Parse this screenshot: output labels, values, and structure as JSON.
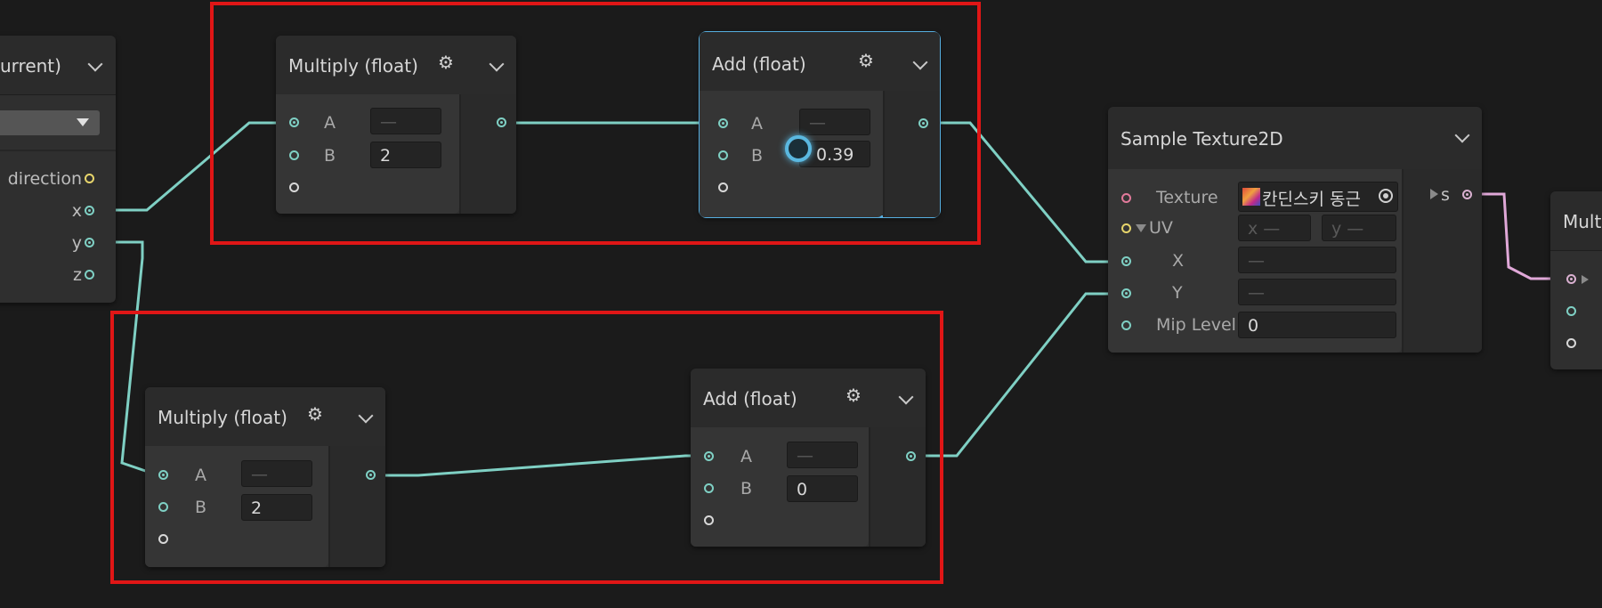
{
  "colors": {
    "background": "#1b1b1b",
    "wire": "#7fd0c4",
    "wire_pink": "#e0a8d8",
    "highlight_red": "#e01616",
    "selected_outline": "#56aee0"
  },
  "left_node": {
    "title_fragment": "urrent)",
    "ports": [
      {
        "label": "direction",
        "icon": "port-yellow"
      },
      {
        "label": "x"
      },
      {
        "label": "y"
      },
      {
        "label": "z"
      }
    ]
  },
  "multiply_top": {
    "title": "Multiply (float)",
    "port_a": "A",
    "port_b": "B",
    "value_a": "—",
    "value_b": "2"
  },
  "add_top": {
    "title": "Add (float)",
    "port_a": "A",
    "port_b": "B",
    "value_a": "—",
    "value_b": "0.39",
    "selected": true
  },
  "multiply_bottom": {
    "title": "Multiply (float)",
    "port_a": "A",
    "port_b": "B",
    "value_a": "—",
    "value_b": "2"
  },
  "add_bottom": {
    "title": "Add (float)",
    "port_a": "A",
    "port_b": "B",
    "value_a": "—",
    "value_b": "0"
  },
  "sample_texture": {
    "title": "Sample Texture2D",
    "texture_label": "Texture",
    "texture_value": "칸딘스키 동근",
    "uv_label": "UV",
    "uv_x": "x —",
    "uv_y": "y —",
    "x_label": "X",
    "x_value": "—",
    "y_label": "Y",
    "y_value": "—",
    "mip_label": "Mip Level",
    "mip_value": "0",
    "output_label": "s"
  },
  "right_node": {
    "title_fragment": "Mult"
  }
}
